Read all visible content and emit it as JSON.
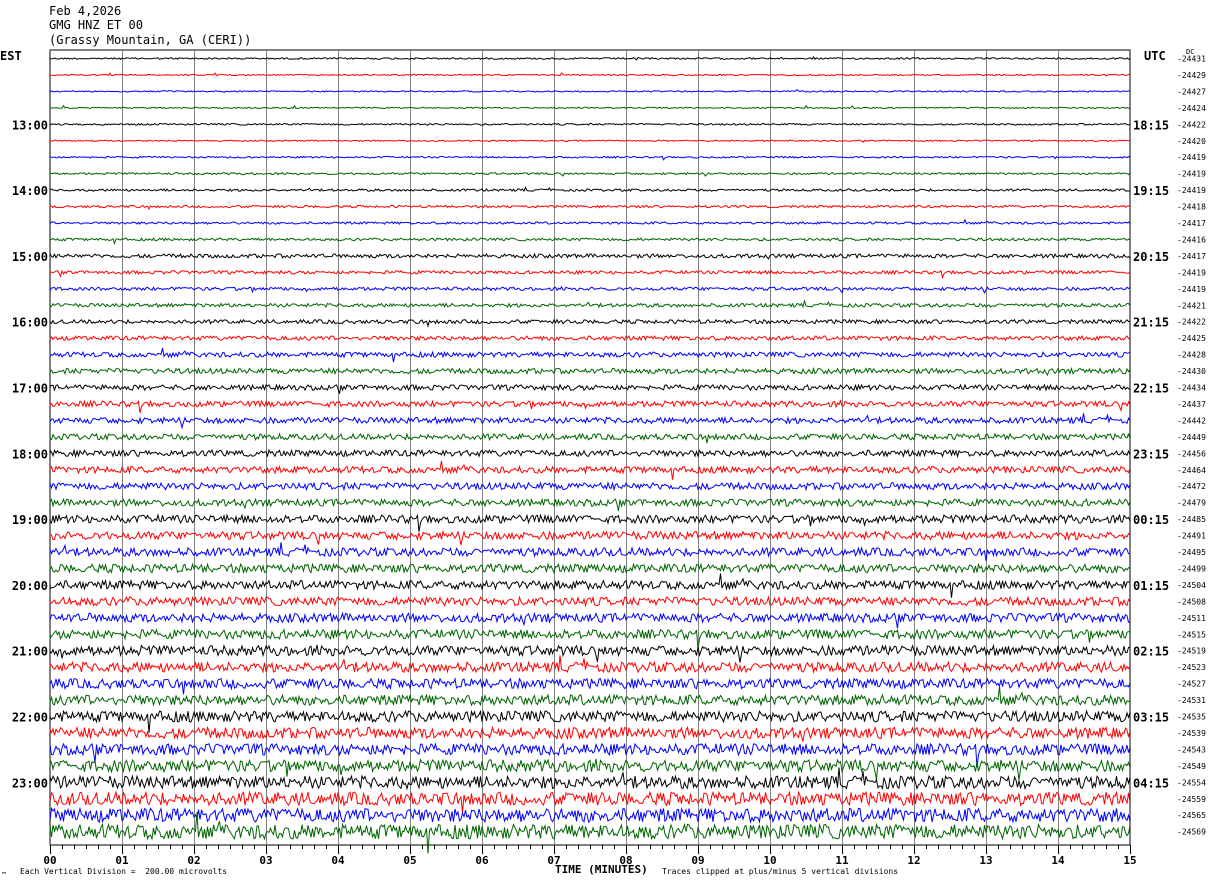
{
  "header": {
    "date": "Feb 4,2026",
    "channel": "GMG HNZ ET 00",
    "station": "(Grassy Mountain, GA (CERI))"
  },
  "left_timezone": "EST",
  "right_timezone": "UTC",
  "dc_label": "DC",
  "footer": {
    "vertical_division": "Each Vertical Division =  200.00 microvolts",
    "clip_note": "Traces clipped at plus/minus 5 vertical divisions",
    "x_axis_label": "TIME (MINUTES)",
    "corner_mark": "™"
  },
  "colors": {
    "trace_cycle": [
      "#000000",
      "#ff0000",
      "#0000ff",
      "#006400"
    ],
    "grid": "#808080",
    "frame": "#000000"
  },
  "chart_data": {
    "type": "line",
    "title": "",
    "xlabel": "TIME (MINUTES)",
    "ylabel": "",
    "xlim": [
      0,
      15
    ],
    "x_ticks": [
      "00",
      "01",
      "02",
      "03",
      "04",
      "05",
      "06",
      "07",
      "08",
      "09",
      "10",
      "11",
      "12",
      "13",
      "14",
      "15"
    ],
    "hour_labels_left": [
      "13:00",
      "14:00",
      "15:00",
      "16:00",
      "17:00",
      "18:00",
      "19:00",
      "20:00",
      "21:00",
      "22:00",
      "23:00"
    ],
    "hour_labels_right": [
      "18:15",
      "19:15",
      "20:15",
      "21:15",
      "22:15",
      "23:15",
      "00:15",
      "01:15",
      "02:15",
      "03:15",
      "04:15"
    ],
    "hour_label_first_row": 4,
    "dc_offsets": [
      "-24431",
      "-24429",
      "-24427",
      "-24424",
      "-24422",
      "-24420",
      "-24419",
      "-24419",
      "-24419",
      "-24418",
      "-24417",
      "-24416",
      "-24417",
      "-24419",
      "-24419",
      "-24421",
      "-24422",
      "-24425",
      "-24428",
      "-24430",
      "-24434",
      "-24437",
      "-24442",
      "-24449",
      "-24456",
      "-24464",
      "-24472",
      "-24479",
      "-24485",
      "-24491",
      "-24495",
      "-24499",
      "-24504",
      "-24508",
      "-24511",
      "-24515",
      "-24519",
      "-24523",
      "-24527",
      "-24531",
      "-24535",
      "-24539",
      "-24543",
      "-24549",
      "-24554",
      "-24559",
      "-24565",
      "-24569"
    ],
    "noise_amplitude_divisions": [
      0.05,
      0.04,
      0.04,
      0.04,
      0.05,
      0.04,
      0.05,
      0.06,
      0.07,
      0.07,
      0.07,
      0.08,
      0.12,
      0.1,
      0.1,
      0.11,
      0.12,
      0.13,
      0.15,
      0.16,
      0.16,
      0.17,
      0.18,
      0.18,
      0.19,
      0.2,
      0.21,
      0.21,
      0.24,
      0.24,
      0.25,
      0.26,
      0.26,
      0.26,
      0.27,
      0.28,
      0.3,
      0.3,
      0.3,
      0.31,
      0.33,
      0.34,
      0.34,
      0.36,
      0.38,
      0.4,
      0.42,
      0.44
    ]
  }
}
